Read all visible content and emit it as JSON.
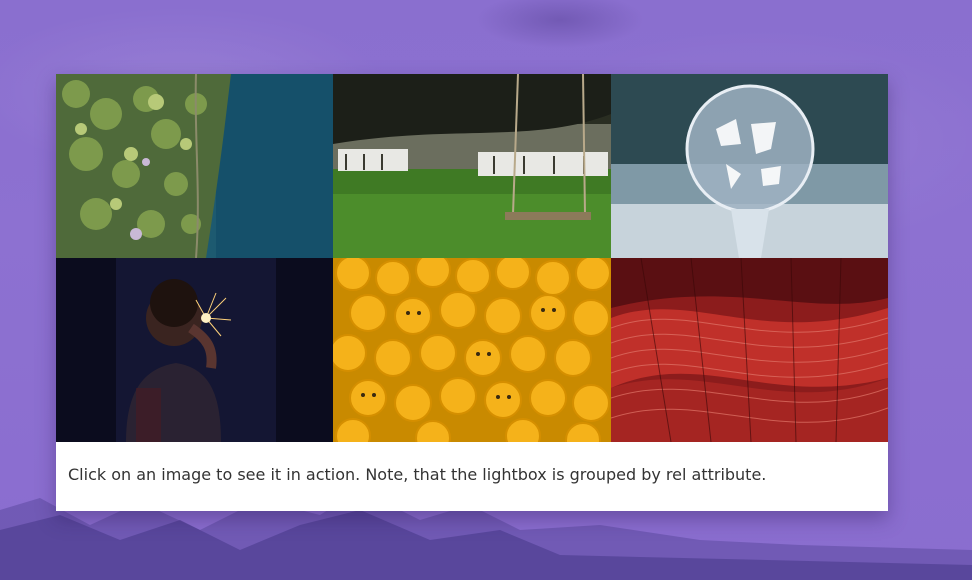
{
  "gallery": {
    "rel": "lightbox-group",
    "images": [
      {
        "subject": "aerial forest and lake"
      },
      {
        "subject": "garden swing wedding lawn"
      },
      {
        "subject": "frozen soap bubble"
      },
      {
        "subject": "person holding sparkler"
      },
      {
        "subject": "pile of yellow toy heads"
      },
      {
        "subject": "red tiled architecture"
      }
    ]
  },
  "caption": "Click on an image to see it in action. Note, that the lightbox is grouped by rel attribute.",
  "colors": {
    "background": "#8a6ccc",
    "card": "#ffffff",
    "text": "#333333"
  }
}
